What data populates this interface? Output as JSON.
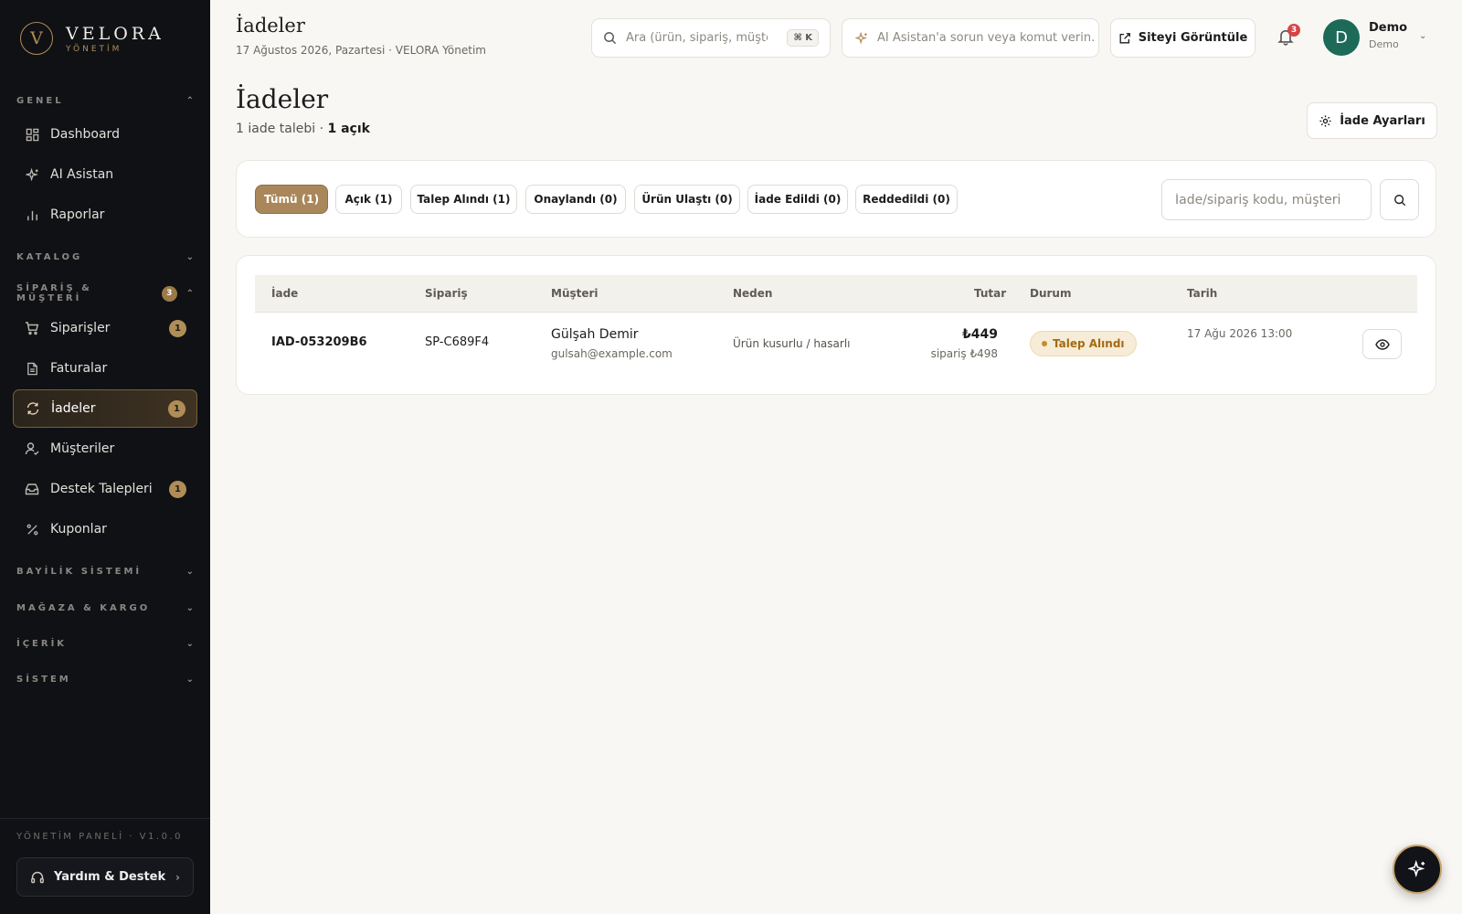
{
  "brand": {
    "logo_letter": "V",
    "name": "VELORA",
    "sub": "YÖNETİM"
  },
  "sidebar": {
    "sections": {
      "genel": "GENEL",
      "katalog": "KATALOG",
      "siparis": "SİPARİŞ & MÜŞTERİ",
      "siparis_badge": "3",
      "bayilik": "BAYİLİK SİSTEMİ",
      "magaza": "MAĞAZA & KARGO",
      "icerik": "İÇERİK",
      "sistem": "SİSTEM"
    },
    "items": {
      "dashboard": "Dashboard",
      "ai": "AI Asistan",
      "raporlar": "Raporlar",
      "siparisler": "Siparişler",
      "siparisler_badge": "1",
      "faturalar": "Faturalar",
      "iadeler": "İadeler",
      "iadeler_badge": "1",
      "musteriler": "Müşteriler",
      "destek": "Destek Talepleri",
      "destek_badge": "1",
      "kuponlar": "Kuponlar"
    },
    "version": "YÖNETİM PANELİ · V1.0.0",
    "help": "Yardım & Destek"
  },
  "header": {
    "title": "İadeler",
    "date": "17 Ağustos 2026, Pazartesi · VELORA Yönetim",
    "search_placeholder": "Ara (ürün, sipariş, müşteri)",
    "search_kbd": "⌘ K",
    "ai_placeholder": "AI Asistan'a sorun veya komut verin.",
    "site_button": "Siteyi Görüntüle",
    "notif_count": "3",
    "avatar_letter": "D",
    "user_name": "Demo",
    "user_role": "Demo"
  },
  "page": {
    "title": "İadeler",
    "summary_prefix": "1 iade talebi · ",
    "summary_open": "1 açık",
    "settings_button": "İade Ayarları"
  },
  "filters": {
    "chips": [
      "Tümü (1)",
      "Açık (1)",
      "Talep Alındı (1)",
      "Onaylandı (0)",
      "Ürün Ulaştı (0)",
      "İade Edildi (0)",
      "Reddedildi (0)"
    ],
    "active_index": 0,
    "search_placeholder": "İade/sipariş kodu, müşteri"
  },
  "table": {
    "columns": [
      "İade",
      "Sipariş",
      "Müşteri",
      "Neden",
      "Tutar",
      "Durum",
      "Tarih"
    ],
    "rows": [
      {
        "iade": "IAD-053209B6",
        "siparis": "SP-C689F4",
        "musteri": "Gülşah Demir",
        "email": "gulsah@example.com",
        "neden": "Ürün kusurlu / hasarlı",
        "tutar": "₺449",
        "siparis_tutar": "sipariş ₺498",
        "durum": "Talep Alındı",
        "tarih": "17 Ağu 2026 13:00"
      }
    ]
  },
  "colors": {
    "accent": "#b08d57",
    "sidebar_bg": "#0f1115",
    "status": "#a36b14",
    "avatar": "#1c6a57"
  }
}
